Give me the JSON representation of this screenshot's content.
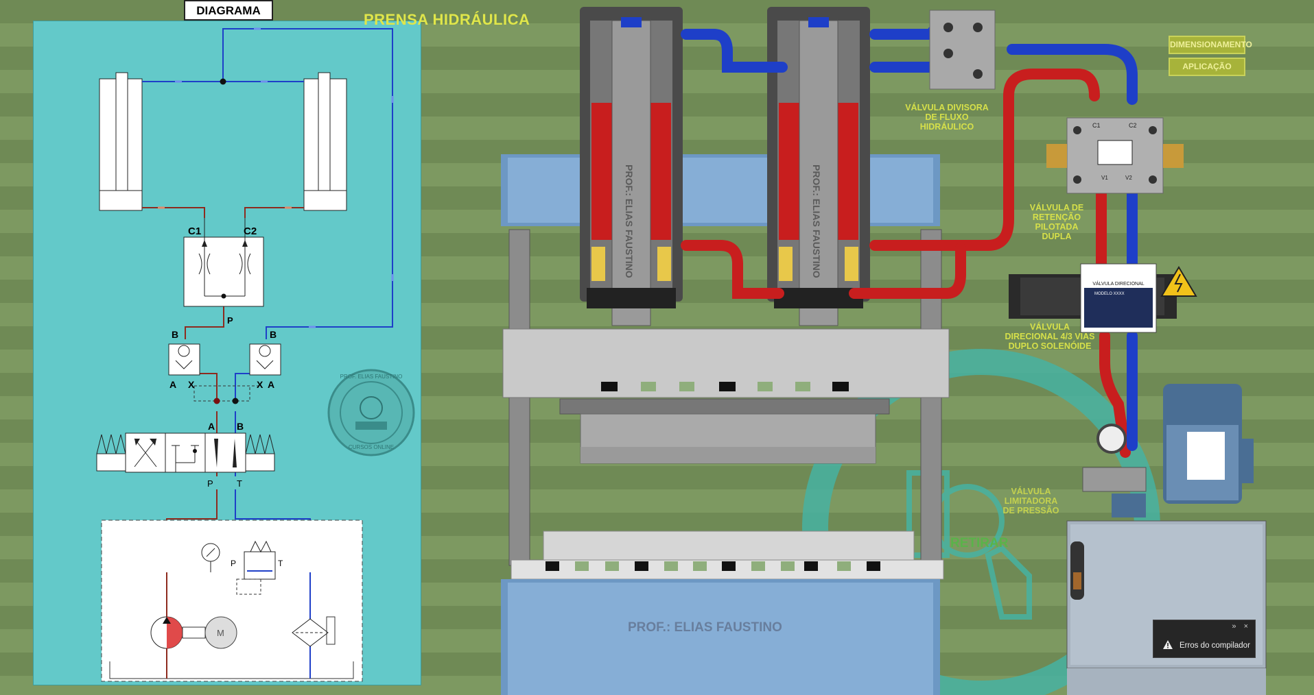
{
  "diagram_tab": "DIAGRAMA",
  "app_title": "PRENSA HIDRÁULICA",
  "buttons": {
    "dimensionamento": "DIMENSIONAMENTO",
    "aplicacao": "APLICAÇÃO"
  },
  "schematic": {
    "port_c1": "C1",
    "port_c2": "C2",
    "port_p": "P",
    "port_b_left": "B",
    "port_b_right": "B",
    "port_a_left": "A",
    "port_x_left": "X",
    "port_x_right": "X",
    "port_a_right": "A",
    "valve_a": "A",
    "valve_b": "B",
    "valve_p": "P",
    "valve_t": "T",
    "relief_p": "P",
    "relief_t": "T",
    "motor_m": "M"
  },
  "stamp": {
    "ring_text": "PROF. ELIAS FAUSTINO",
    "bottom_text": "CURSOS ONLINE"
  },
  "labels": {
    "flow_divider": [
      "VÁLVULA DIVISORA",
      "DE FLUXO",
      "HIDRÁULICO"
    ],
    "check_valve": [
      "VÁLVULA DE",
      "RETENÇÃO",
      "PILOTADA",
      "DUPLA"
    ],
    "directional": [
      "VÁLVULA",
      "DIRECIONAL  4/3 VIAS",
      "DUPLO SOLENÓIDE"
    ],
    "relief": [
      "VÁLVULA",
      "LIMITADORA",
      "DE PRESSÃO"
    ],
    "valve_plate_title": "VÁLVULA DIRECIONAL",
    "valve_plate_model": "MODELO XXXX",
    "cylinder_text": "PROF.: ELIAS FAUSTINO",
    "block_c1": "C1",
    "block_c2": "C2",
    "block_v1": "V1",
    "block_v2": "V2"
  },
  "watermark_text": "PROF.: ELIAS FAUSTINO",
  "retirar": "RETIRAR",
  "toast": {
    "controls": "» ×",
    "message": "Erros do compilador"
  },
  "colors": {
    "pressure": "#d62828",
    "return": "#1e3fc8",
    "panel": "#63c9c9",
    "label": "#d6e04a"
  }
}
